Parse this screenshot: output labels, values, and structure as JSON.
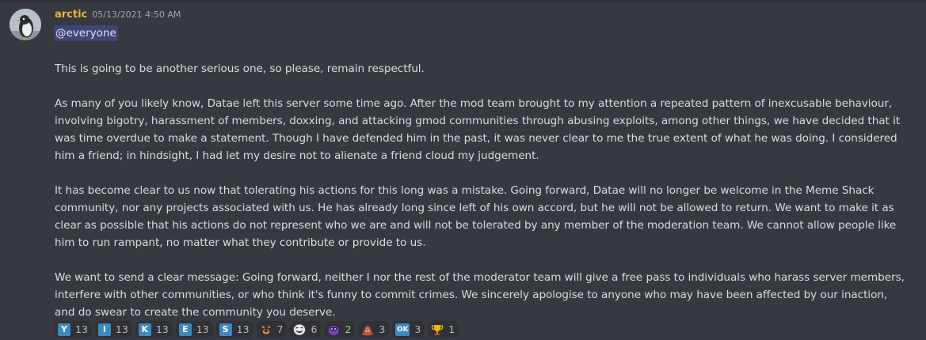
{
  "message": {
    "author": "arctic",
    "author_color": "#f0b232",
    "timestamp": "05/13/2021 4:50 AM",
    "mention": "@everyone",
    "paragraphs": [
      "This is going to be another serious one, so please, remain respectful.",
      "As many of you likely know, Datae left this server some time ago. After the mod team brought to my attention a repeated pattern of inexcusable behaviour, involving bigotry, harassment of members, doxxing, and attacking gmod communities through abusing exploits, among other things, we have decided that it was time overdue to make a statement. Though I have defended him in the past, it was never clear to me the true extent of what he was doing. I considered him a friend; in hindsight, I had let my desire not to alienate a friend cloud my judgement.",
      "It has become clear to us now that tolerating his actions for this long was a mistake. Going forward, Datae will no longer be welcome in the Meme Shack community, nor any projects associated with us. He has already long since left of his own accord, but he will not be allowed to return. We want to make it as clear as possible that his actions do not represent who we are and will not be tolerated by any member of the moderation team. We cannot allow people like him to run rampant, no matter what they contribute or provide to us.",
      "We want to send a clear message: Going forward, neither I nor the rest of the moderator team will give a free pass to individuals who harass server members, interfere with other communities, or who think it's funny to commit crimes. We sincerely apologise to anyone who may have been affected by our inaction, and do swear to create the community you deserve."
    ]
  },
  "reactions": [
    {
      "icon": "regional-indicator-y-icon",
      "glyph": "Y",
      "count": "13"
    },
    {
      "icon": "regional-indicator-i-icon",
      "glyph": "I",
      "count": "13"
    },
    {
      "icon": "regional-indicator-k-icon",
      "glyph": "K",
      "count": "13"
    },
    {
      "icon": "regional-indicator-e-icon",
      "glyph": "E",
      "count": "13"
    },
    {
      "icon": "regional-indicator-s-icon",
      "glyph": "S",
      "count": "13"
    },
    {
      "icon": "custom-face-emote-icon",
      "glyph": "",
      "count": "7"
    },
    {
      "icon": "trollface-emote-icon",
      "glyph": "",
      "count": "6"
    },
    {
      "icon": "purple-amogus-emote-icon",
      "glyph": "",
      "count": "2"
    },
    {
      "icon": "pile-of-poo-icon",
      "glyph": "",
      "count": "3"
    },
    {
      "icon": "ok-button-icon",
      "glyph": "OK",
      "count": "3"
    },
    {
      "icon": "trophy-icon",
      "glyph": "",
      "count": "1"
    }
  ],
  "colors": {
    "background": "#36393f",
    "text": "#dcddde",
    "mention_bg": "rgba(88,101,242,0.3)",
    "reaction_bg": "#2f3136"
  }
}
